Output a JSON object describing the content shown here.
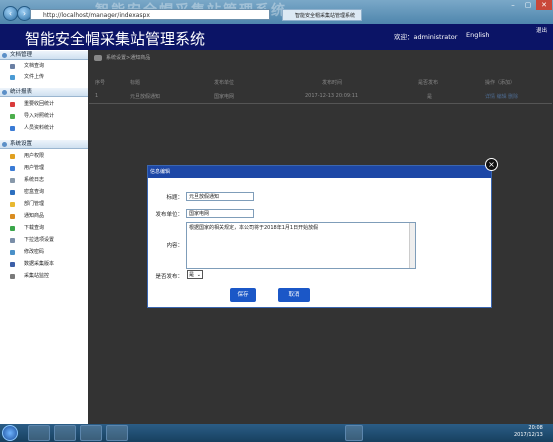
{
  "browser": {
    "url": "http://localhost/manager/indexaspx",
    "tab_title": "智能安全帽采集站管理系统",
    "window_title_ghost": "智能安全帽采集站管理系统"
  },
  "header": {
    "app_title": "智能安全帽采集站管理系统",
    "welcome": "欢迎：administrator",
    "language": "English",
    "logout": "退出"
  },
  "sidebar": {
    "sections": [
      {
        "label": "文档管理",
        "items": [
          "文档查询",
          "文件上传"
        ]
      },
      {
        "label": "统计报表",
        "items": [
          "重要收回统计",
          "导入对照统计",
          "人员资料统计"
        ]
      },
      {
        "label": "系统设置",
        "items": [
          "用户权限",
          "用户管理",
          "系统日志",
          "密盒查询",
          "部门管理",
          "通知商品",
          "下载查询",
          "下拉选项设置",
          "修改密码",
          "数据采集版本",
          "采集站监控"
        ]
      }
    ]
  },
  "breadcrumb": "系统设置>通知商品",
  "table": {
    "headers": [
      "序号",
      "标题",
      "发布单位",
      "发布时间",
      "是否发布",
      "操作（添加）"
    ],
    "rows": [
      {
        "no": "1",
        "title": "元旦放假通知",
        "unit": "国家电网",
        "time": "2017-12-13 20:09:11",
        "published": "是",
        "ops": "详情 编辑 删除"
      }
    ]
  },
  "dialog": {
    "title": "信息编辑",
    "fields": {
      "title_label": "标题：",
      "title_value": "元旦放假通知",
      "unit_label": "发布单位：",
      "unit_value": "国家电网",
      "content_label": "内容：",
      "content_value": "根据国家的相关规定，本公司将于2018年1月1日开始放假",
      "publish_label": "是否发布：",
      "publish_value": "是"
    },
    "save_label": "保存",
    "cancel_label": "取消",
    "close_icon": "×"
  },
  "taskbar": {
    "time": "20:08",
    "date": "2017/12/13"
  },
  "colors": {
    "header_bg": "#0b1466",
    "dialog_header_bg": "#1d47a6",
    "button_bg": "#1b57c7"
  }
}
